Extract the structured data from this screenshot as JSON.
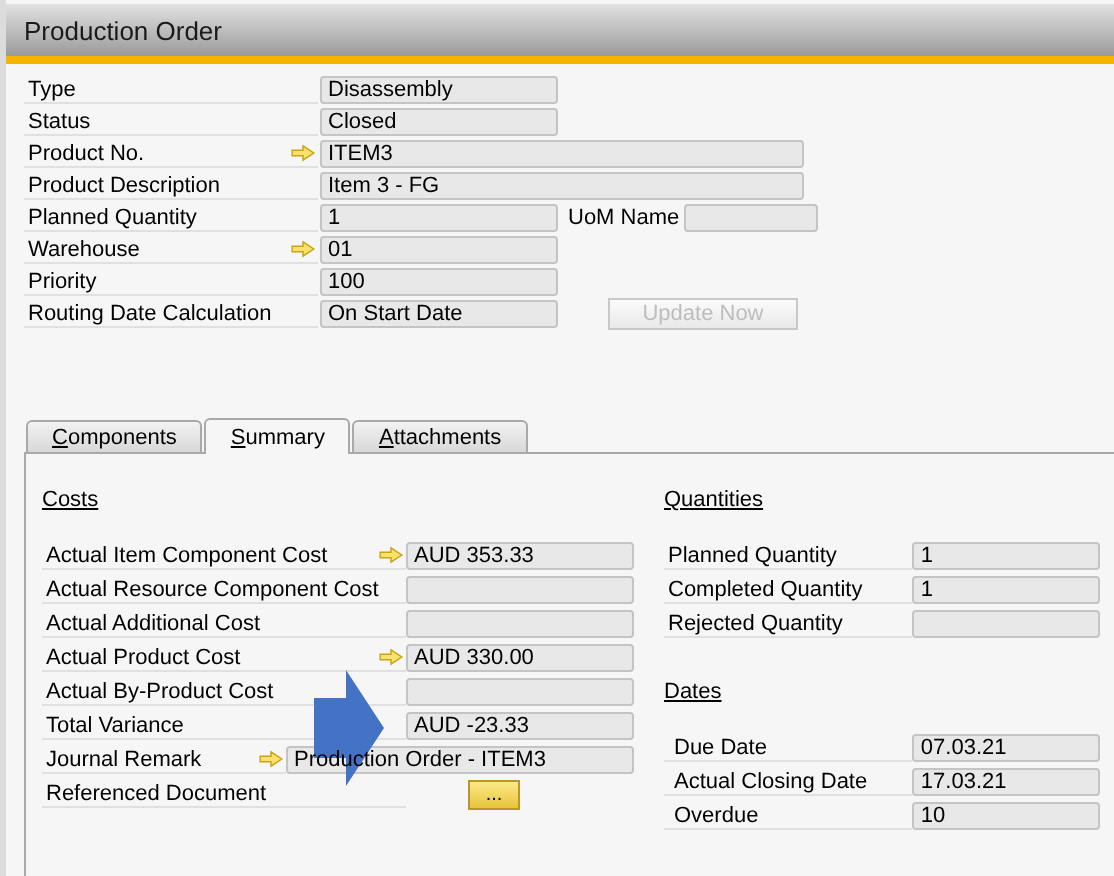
{
  "window": {
    "title": "Production Order"
  },
  "header_fields": [
    {
      "label": "Type",
      "value": "Disassembly",
      "link": false,
      "kind": "short"
    },
    {
      "label": "Status",
      "value": "Closed",
      "link": false,
      "kind": "short"
    },
    {
      "label": "Product No.",
      "value": "ITEM3",
      "link": true,
      "kind": "long"
    },
    {
      "label": "Product Description",
      "value": "Item 3 - FG",
      "link": false,
      "kind": "long"
    },
    {
      "label": "Planned Quantity",
      "value": "1",
      "link": false,
      "kind": "short",
      "extra": {
        "label": "UoM Name"
      }
    },
    {
      "label": "Warehouse",
      "value": "01",
      "link": true,
      "kind": "short"
    },
    {
      "label": "Priority",
      "value": "100",
      "link": false,
      "kind": "short"
    },
    {
      "label": "Routing Date Calculation",
      "value": "On Start Date",
      "link": false,
      "kind": "short",
      "button": {
        "label": "Update Now",
        "disabled": true
      }
    }
  ],
  "tabs": [
    {
      "label": "Components",
      "selected": false
    },
    {
      "label": "Summary",
      "selected": true
    },
    {
      "label": "Attachments",
      "selected": false
    }
  ],
  "costs": {
    "title": "Costs",
    "rows": [
      {
        "label": "Actual Item Component Cost",
        "value": "AUD 353.33",
        "link": true,
        "kind": "field"
      },
      {
        "label": "Actual Resource Component Cost",
        "link": false,
        "kind": "field"
      },
      {
        "label": "Actual Additional Cost",
        "link": false,
        "kind": "field"
      },
      {
        "label": "Actual Product Cost",
        "value": "AUD 330.00",
        "link": true,
        "kind": "field"
      },
      {
        "label": "Actual By-Product Cost",
        "link": false,
        "kind": "field"
      },
      {
        "label": "Total Variance",
        "value": "AUD -23.33",
        "link": false,
        "kind": "field"
      },
      {
        "label": "Journal Remark",
        "value": "Production Order - ITEM3",
        "link": true,
        "kind": "wide"
      },
      {
        "label": "Referenced Document",
        "value": "...",
        "link": false,
        "kind": "button"
      }
    ]
  },
  "quantities": {
    "title": "Quantities",
    "rows": [
      {
        "label": "Planned Quantity",
        "value": "1"
      },
      {
        "label": "Completed Quantity",
        "value": "1"
      },
      {
        "label": "Rejected Quantity"
      }
    ]
  },
  "dates": {
    "title": "Dates",
    "rows": [
      {
        "label": "Due Date",
        "value": "07.03.21"
      },
      {
        "label": "Actual Closing Date",
        "value": "17.03.21"
      },
      {
        "label": "Overdue",
        "value": "10"
      }
    ]
  },
  "annotation": {
    "kind": "arrow"
  }
}
